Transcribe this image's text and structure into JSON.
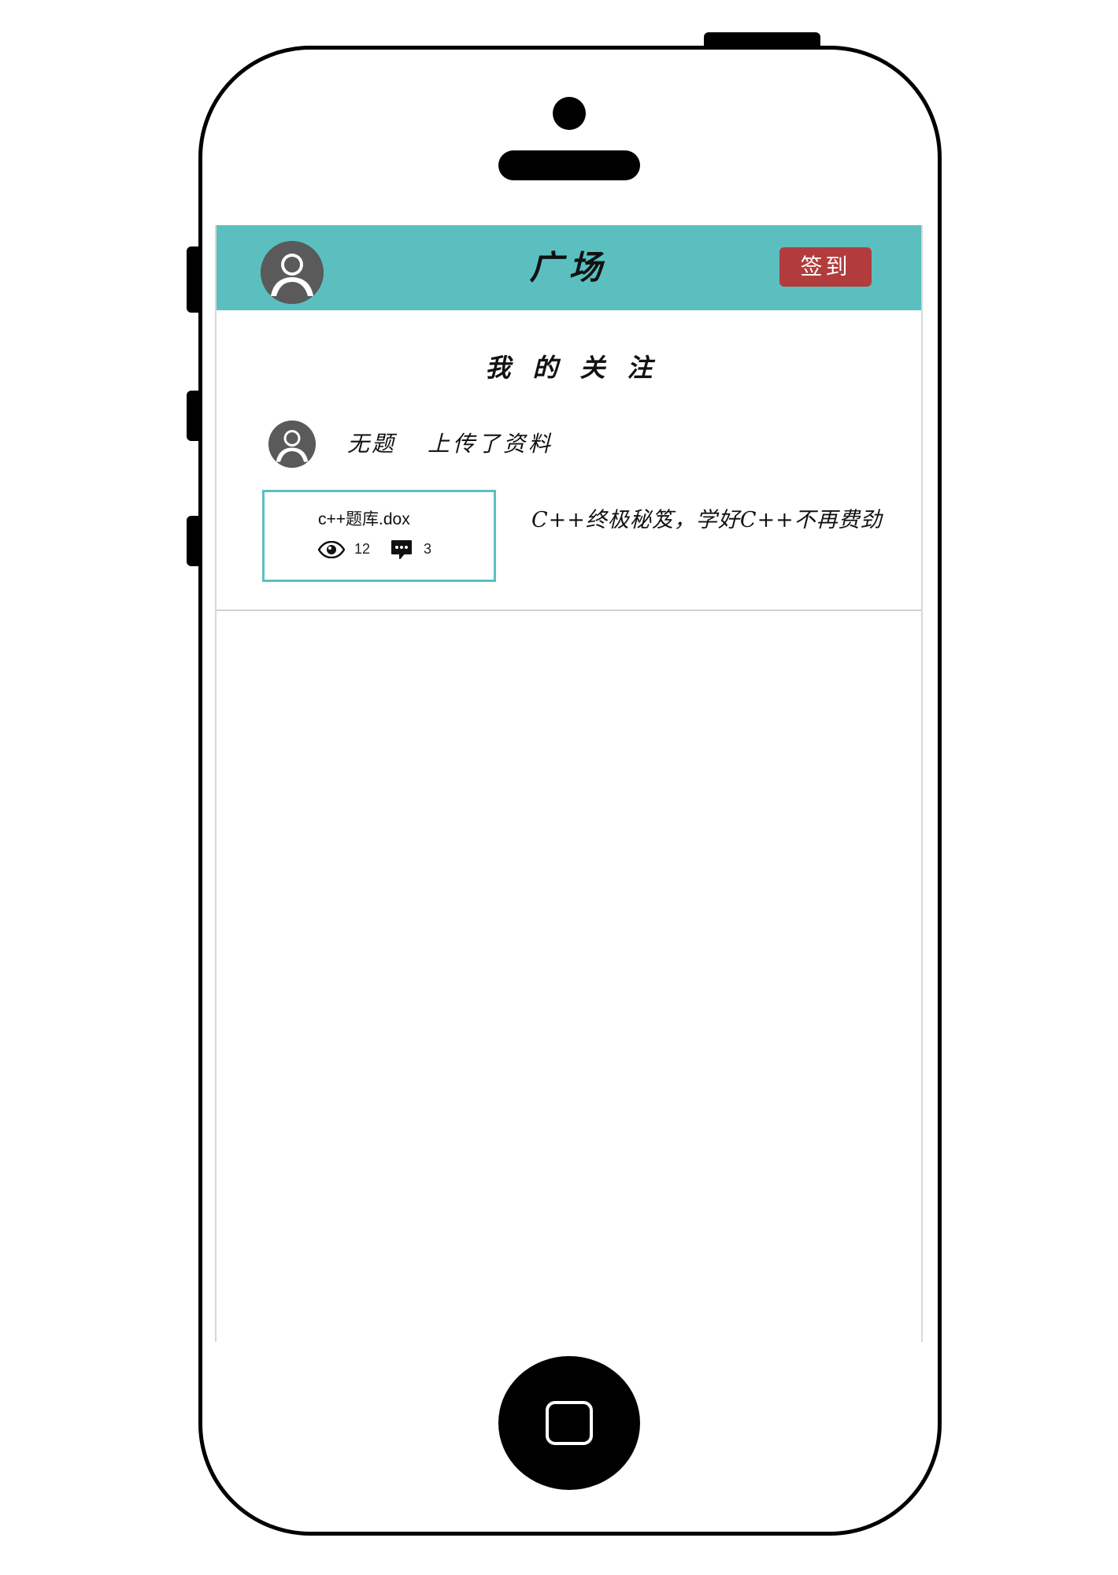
{
  "header": {
    "title": "广场",
    "signin_label": "签到"
  },
  "section": {
    "title": "我的关注"
  },
  "feed": [
    {
      "user": "无题",
      "action": "上传了资料",
      "file_name": "c++题库.dox",
      "views": "12",
      "comments": "3",
      "description": "C++终极秘笈，学好C++不再费劲"
    }
  ],
  "colors": {
    "header_bg": "#5bbfc0",
    "signin_bg": "#b23c3c",
    "card_border": "#5bbfc0",
    "avatar": "#5a5a5a"
  },
  "icons": {
    "avatar": "user-avatar-icon",
    "views": "eye-icon",
    "comments": "comment-bubble-icon",
    "home": "home-button-icon"
  }
}
